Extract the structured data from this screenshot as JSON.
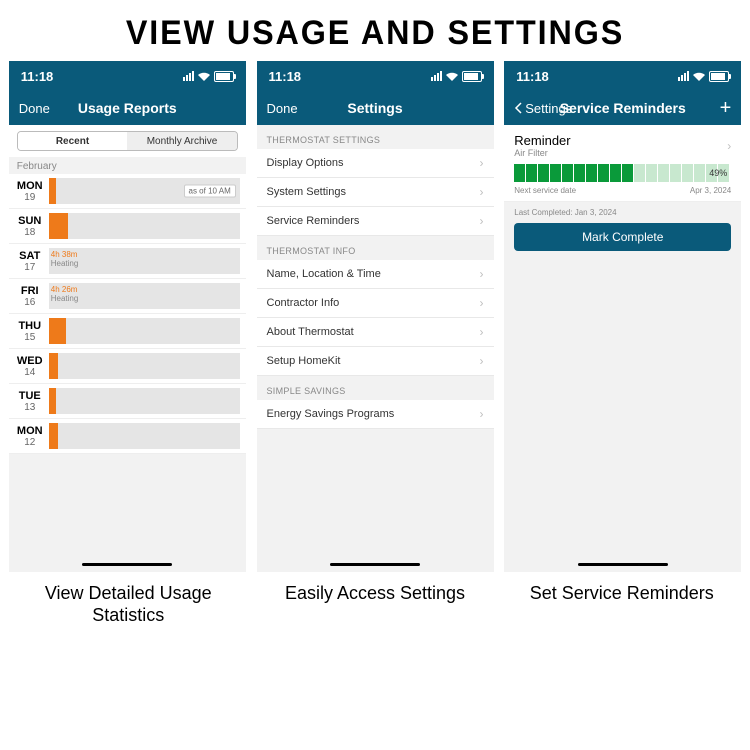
{
  "title": "VIEW USAGE AND SETTINGS",
  "clock": "11:18",
  "captions": [
    "View Detailed Usage Statistics",
    "Easily Access Settings",
    "Set Service Reminders"
  ],
  "usage": {
    "nav_left": "Done",
    "nav_title": "Usage Reports",
    "seg_recent": "Recent",
    "seg_archive": "Monthly Archive",
    "month": "February",
    "asof": "as of 10 AM",
    "days": [
      {
        "dow": "MON",
        "num": "19",
        "fill": 4,
        "label": "",
        "sub": ""
      },
      {
        "dow": "SUN",
        "num": "18",
        "fill": 10,
        "label": "",
        "sub": ""
      },
      {
        "dow": "SAT",
        "num": "17",
        "fill": 0,
        "label": "4h 38m",
        "sub": "Heating"
      },
      {
        "dow": "FRI",
        "num": "16",
        "fill": 0,
        "label": "4h 26m",
        "sub": "Heating"
      },
      {
        "dow": "THU",
        "num": "15",
        "fill": 9,
        "label": "",
        "sub": ""
      },
      {
        "dow": "WED",
        "num": "14",
        "fill": 5,
        "label": "",
        "sub": ""
      },
      {
        "dow": "TUE",
        "num": "13",
        "fill": 4,
        "label": "",
        "sub": ""
      },
      {
        "dow": "MON",
        "num": "12",
        "fill": 5,
        "label": "",
        "sub": ""
      }
    ]
  },
  "settings": {
    "nav_left": "Done",
    "nav_title": "Settings",
    "groups": [
      {
        "header": "THERMOSTAT SETTINGS",
        "items": [
          "Display Options",
          "System Settings",
          "Service Reminders"
        ]
      },
      {
        "header": "THERMOSTAT INFO",
        "items": [
          "Name, Location & Time",
          "Contractor Info",
          "About Thermostat",
          "Setup HomeKit"
        ]
      },
      {
        "header": "SIMPLE SAVINGS",
        "items": [
          "Energy Savings Programs"
        ]
      }
    ]
  },
  "service": {
    "nav_back": "Settings",
    "nav_title": "Service Reminders",
    "reminder_title": "Reminder",
    "reminder_sub": "Air Filter",
    "percent": "49%",
    "progress_filled": 10,
    "progress_total": 18,
    "next_label": "Next service date",
    "next_value": "Apr 3, 2024",
    "last_completed": "Last Completed: Jan 3, 2024",
    "mark_btn": "Mark Complete"
  }
}
